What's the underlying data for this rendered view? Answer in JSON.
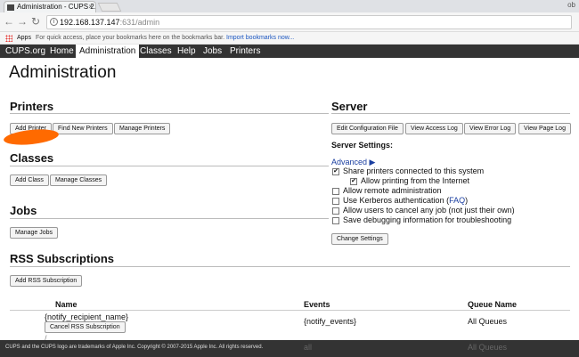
{
  "browser": {
    "tab_title": "Administration - CUPS 2.",
    "tab_close": "×",
    "window_controls": "ob",
    "back": "←",
    "forward": "→",
    "reload": "↻",
    "address_host": "192.168.137.147",
    "address_path": ":631/admin",
    "apps_label": "Apps",
    "bookmarks_hint": "For quick access, place your bookmarks here on the bookmarks bar.",
    "bookmarks_link": "Import bookmarks now..."
  },
  "nav": {
    "items": [
      "CUPS.org",
      "Home",
      "Administration",
      "Classes",
      "Help",
      "Jobs",
      "Printers"
    ]
  },
  "page": {
    "title": "Administration"
  },
  "printers": {
    "heading": "Printers",
    "buttons": [
      "Add Printer",
      "Find New Printers",
      "Manage Printers"
    ]
  },
  "classes": {
    "heading": "Classes",
    "buttons": [
      "Add Class",
      "Manage Classes"
    ]
  },
  "jobs": {
    "heading": "Jobs",
    "buttons": [
      "Manage Jobs"
    ]
  },
  "server": {
    "heading": "Server",
    "buttons": [
      "Edit Configuration File",
      "View Access Log",
      "View Error Log",
      "View Page Log"
    ],
    "settings_label": "Server Settings:",
    "advanced": "Advanced ▶",
    "options": [
      {
        "label": "Share printers connected to this system",
        "checked": true
      },
      {
        "label": "Allow printing from the Internet",
        "checked": true
      },
      {
        "label": "Allow remote administration",
        "checked": false
      },
      {
        "label_pre": "Use Kerberos authentication (",
        "label_link": "FAQ",
        "label_post": ")",
        "checked": false
      },
      {
        "label": "Allow users to cancel any job (not just their own)",
        "checked": false
      },
      {
        "label": "Save debugging information for troubleshooting",
        "checked": false
      }
    ],
    "change_settings": "Change Settings"
  },
  "rss": {
    "heading": "RSS Subscriptions",
    "add_button": "Add RSS Subscription",
    "columns": [
      "Name",
      "Events",
      "Queue Name"
    ],
    "rows": [
      {
        "name": "{notify_recipient_name}",
        "cancel": "Cancel RSS Subscription",
        "events": "{notify_events}",
        "queue": "All Queues"
      }
    ],
    "ghost_slash": "/",
    "ghost_events": "all",
    "ghost_queue": "All Queues"
  },
  "footer": {
    "text": "CUPS and the CUPS logo are trademarks of Apple Inc. Copyright © 2007-2015 Apple Inc. All rights reserved."
  },
  "colors": {
    "nav_bg": "#333333",
    "annotation": "#ff6a00",
    "link": "#1a3ea0"
  }
}
